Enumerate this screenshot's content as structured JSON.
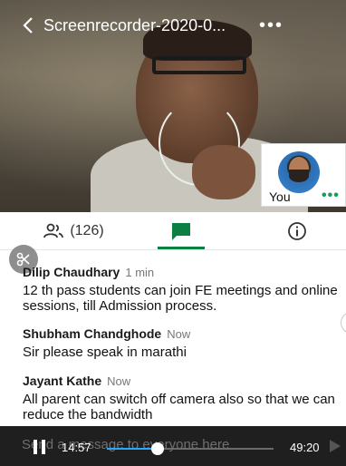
{
  "header": {
    "title": "Screenrecorder-2020-0...",
    "back_icon": "chevron-left-icon",
    "more_icon": "more-horizontal-icon",
    "more_label": "•••"
  },
  "self_view": {
    "label": "You",
    "more_label": "•••"
  },
  "tabs": {
    "people_count": "(126)",
    "people_icon": "people-icon",
    "chat_icon": "chat-icon",
    "info_icon": "info-icon",
    "active": "chat",
    "accent": "#0b8043"
  },
  "messages": [
    {
      "name": "Dilip Chaudhary",
      "time": "1 min",
      "text": "12 th  pass students can join FE meetings and online sessions, till Admission process."
    },
    {
      "name": "Shubham Chandghode",
      "time": "Now",
      "text": "Sir please speak in marathi"
    },
    {
      "name": "Jayant Kathe",
      "time": "Now",
      "text": "All parent can switch off camera also so that we can reduce the bandwidth"
    }
  ],
  "composer": {
    "placeholder": "Send a message to everyone here"
  },
  "player": {
    "current_time": "14:57",
    "total_time": "49:20",
    "progress": 0.303,
    "accent": "#2aa6ff"
  }
}
